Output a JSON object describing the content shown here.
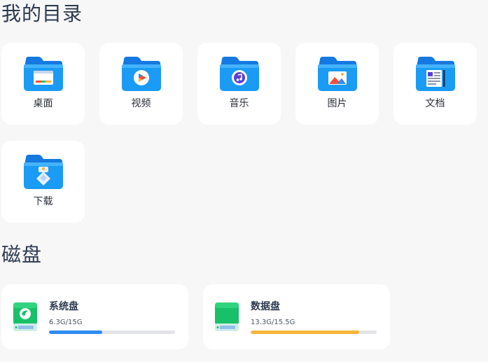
{
  "sections": {
    "directories_title": "我的目录",
    "disks_title": "磁盘"
  },
  "folders": [
    {
      "label": "桌面",
      "icon": "desktop-folder-icon"
    },
    {
      "label": "视频",
      "icon": "video-folder-icon"
    },
    {
      "label": "音乐",
      "icon": "music-folder-icon"
    },
    {
      "label": "图片",
      "icon": "pictures-folder-icon"
    },
    {
      "label": "文档",
      "icon": "documents-folder-icon"
    },
    {
      "label": "下载",
      "icon": "downloads-folder-icon"
    }
  ],
  "disks": [
    {
      "name": "系统盘",
      "usage": "6.3G/15G",
      "used_fraction": 0.42,
      "bar_color": "#2f8cf0",
      "icon": "system-disk-icon"
    },
    {
      "name": "数据盘",
      "usage": "13.3G/15.5G",
      "used_fraction": 0.86,
      "bar_color": "#f5b43a",
      "icon": "data-disk-icon"
    }
  ],
  "colors": {
    "background": "#f7f7f8",
    "card": "#ffffff",
    "folder_blue": "#1a8cf0",
    "disk_green": "#19c06a"
  }
}
